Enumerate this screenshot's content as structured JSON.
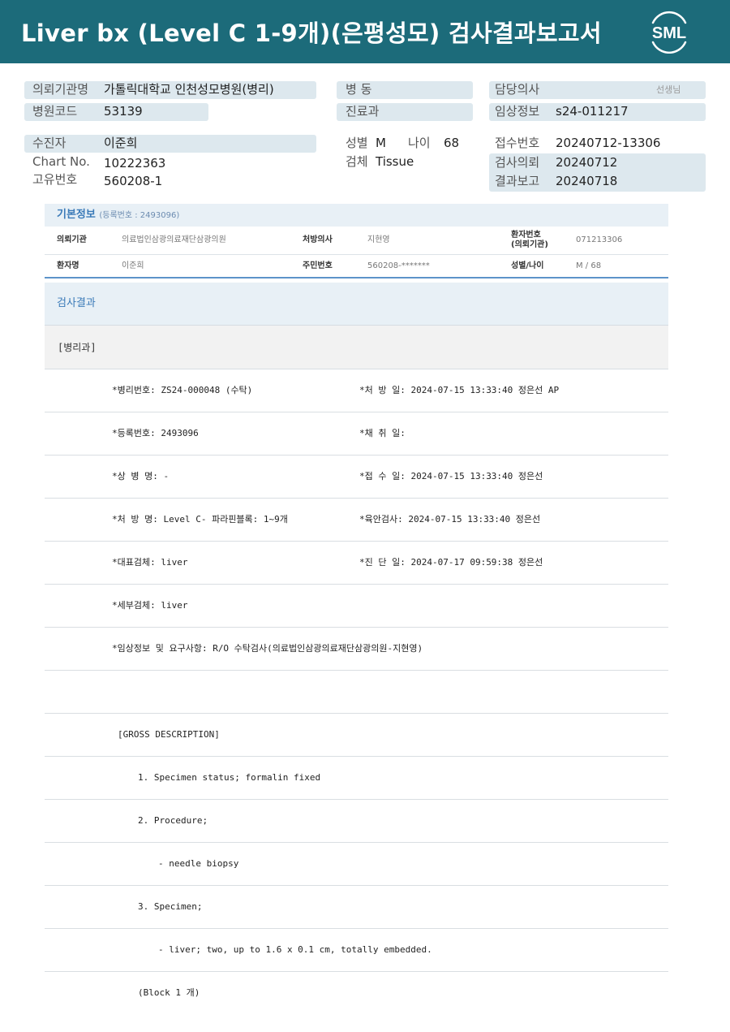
{
  "header": {
    "title": "Liver bx (Level C 1-9개)(은평성모) 검사결과보고서",
    "logo_text": "SML"
  },
  "patient_info": {
    "referring_institution_label": "의뢰기관명",
    "referring_institution": "가톨릭대학교 인천성모병원(병리)",
    "ward_label": "병 동",
    "doctor_label": "담당의사",
    "doctor_suffix": "선생님",
    "hospital_code_label": "병원코드",
    "hospital_code": "53139",
    "department_label": "진료과",
    "clinical_info_label": "임상정보",
    "clinical_info": "s24-011217",
    "examinee_label": "수진자",
    "examinee": "이준희",
    "sex_label": "성별",
    "sex": "M",
    "age_label": "나이",
    "age": "68",
    "reception_no_label": "접수번호",
    "reception_no": "20240712-13306",
    "chart_no_label": "Chart No.",
    "chart_no": "10222363",
    "specimen_label": "검체",
    "specimen": "Tissue",
    "request_date_label": "검사의뢰",
    "request_date": "20240712",
    "unique_no_label": "고유번호",
    "unique_no": "560208-1",
    "report_date_label": "결과보고",
    "report_date": "20240718"
  },
  "basic_info": {
    "title": "기본정보",
    "reg_note": "(등록번호 : 2493096)",
    "inst_label": "의뢰기관",
    "inst": "의료법인삼광의료재단삼광의원",
    "prescriber_label": "처방의사",
    "prescriber": "지현영",
    "patient_no_label_1": "환자번호",
    "patient_no_label_2": "(의뢰기관)",
    "patient_no": "071213306",
    "patient_name_label": "환자명",
    "patient_name": "이준희",
    "resident_no_label": "주민번호",
    "resident_no": "560208-*******",
    "sex_age_label": "성별/나이",
    "sex_age": "M / 68"
  },
  "results": {
    "title": "검사결과",
    "section": "[병리과]",
    "rows": [
      {
        "left": "*병리번호: ZS24-000048 (수탁)",
        "right": "*처 방 일: 2024-07-15 13:33:40  정은선 AP"
      },
      {
        "left": "*등록번호: 2493096",
        "right": "*채 취 일:"
      },
      {
        "left": "*상 병 명: -",
        "right": "*접 수 일: 2024-07-15 13:33:40  정은선"
      },
      {
        "left": "*처 방 명: Level C- 파라핀블록: 1~9개",
        "right": "*육안검사: 2024-07-15 13:33:40  정은선"
      },
      {
        "left": "*대표검체: liver",
        "right": "*진 단 일: 2024-07-17 09:59:38  정은선"
      },
      {
        "left": "*세부검체: liver",
        "right": ""
      },
      {
        "left": "*임상정보 및 요구사항: R/O 수탁검사(의료법인삼광의료재단삼광의원-지현영)",
        "right": ""
      }
    ],
    "gross_title": "[GROSS DESCRIPTION]",
    "gross_lines": [
      "1. Specimen status; formalin fixed",
      "2. Procedure;",
      "- needle biopsy",
      "3. Specimen;",
      "- liver; two, up to 1.6 x 0.1 cm, totally embedded.",
      "(Block 1 개)"
    ]
  }
}
